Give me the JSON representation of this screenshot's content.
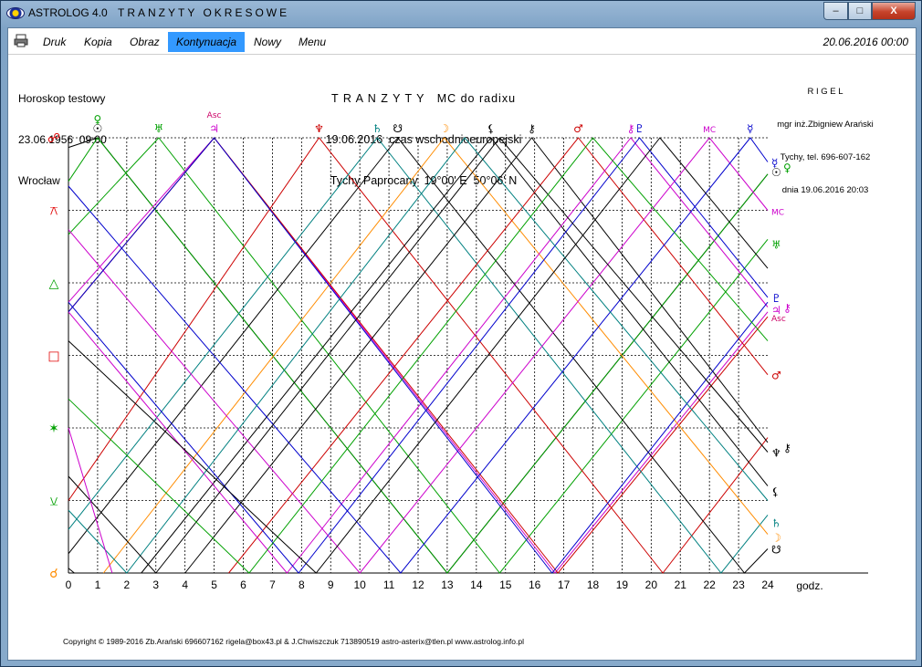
{
  "window": {
    "app_name": "ASTROLOG 4.0",
    "title": "TRANZYTY OKRESOWE",
    "min_label": "–",
    "max_label": "□",
    "close_label": "X"
  },
  "menu": {
    "items": [
      "Druk",
      "Kopia",
      "Obraz",
      "Kontynuacja",
      "Nowy",
      "Menu"
    ],
    "active": "Kontynuacja",
    "date": "20.06.2016  00:00"
  },
  "header": {
    "left": [
      "Horoskop testowy",
      "23.06.1956  09:00",
      "Wrocław"
    ],
    "center_title": "T R A N Z Y T Y   MC do radixu",
    "center_line2": "19.06.2016  czas wschodnioeuropejski",
    "center_line3": "Tychy Paprocany  19°00' E  50°06' N",
    "right": [
      "R I G E L",
      "mgr inż.Zbigniew Arański",
      "Tychy, tel. 696-607-162",
      "dnia 19.06.2016 20:03"
    ]
  },
  "footer": {
    "copyright": "Copyright © 1989-2016 Zb.Arański 696607162 rigela@box43.pl & J.Chwiszczuk 713890519 astro-asterix@tlen.pl www.astrolog.info.pl"
  },
  "chart_data": {
    "type": "line",
    "xlabel": "godz.",
    "x_ticks": [
      0,
      1,
      2,
      3,
      4,
      5,
      6,
      7,
      8,
      9,
      10,
      11,
      12,
      13,
      14,
      15,
      16,
      17,
      18,
      19,
      20,
      21,
      22,
      23,
      24
    ],
    "xlim": [
      0,
      24
    ],
    "ylim": [
      0,
      180
    ],
    "y_aspects": [
      {
        "glyph": "☍",
        "deg": 180,
        "color": "#e00000"
      },
      {
        "glyph": "⚻",
        "deg": 150,
        "color": "#e00000"
      },
      {
        "glyph": "△",
        "deg": 120,
        "color": "#00a000"
      },
      {
        "glyph": "□",
        "deg": 90,
        "color": "#e00000"
      },
      {
        "glyph": "✶",
        "deg": 60,
        "color": "#00a000"
      },
      {
        "glyph": "⚺",
        "deg": 30,
        "color": "#00a000"
      },
      {
        "glyph": "☌",
        "deg": 0,
        "color": "#ff8c00"
      }
    ],
    "top_labels": [
      {
        "glyph": "☉",
        "x": 1.0,
        "color": "#000000"
      },
      {
        "glyph": "♀",
        "x": 1.0,
        "color": "#00a000"
      },
      {
        "glyph": "♅",
        "x": 3.1,
        "color": "#00a000"
      },
      {
        "glyph": "♃",
        "x": 5.0,
        "color": "#cc00cc"
      },
      {
        "glyph": "Asc",
        "x": 5.0,
        "color": "#cc0066"
      },
      {
        "glyph": "♆",
        "x": 8.6,
        "color": "#cc0000"
      },
      {
        "glyph": "♄",
        "x": 10.6,
        "color": "#008080"
      },
      {
        "glyph": "☋",
        "x": 11.3,
        "color": "#000000"
      },
      {
        "glyph": "☽",
        "x": 12.9,
        "color": "#ff8c00"
      },
      {
        "glyph": "⚸",
        "x": 14.5,
        "color": "#000000"
      },
      {
        "glyph": "⚷",
        "x": 15.9,
        "color": "#000000"
      },
      {
        "glyph": "♂",
        "x": 17.5,
        "color": "#cc0000"
      },
      {
        "glyph": "⚷",
        "x": 19.3,
        "color": "#cc00cc"
      },
      {
        "glyph": "♇",
        "x": 19.6,
        "color": "#0000cc"
      },
      {
        "glyph": "MC",
        "x": 22.0,
        "color": "#cc00cc"
      },
      {
        "glyph": "☿",
        "x": 23.4,
        "color": "#0000cc"
      }
    ],
    "right_labels": [
      {
        "glyph": "☿",
        "deg": 170,
        "color": "#0000cc"
      },
      {
        "glyph": "☉",
        "deg": 166,
        "color": "#000000"
      },
      {
        "glyph": "♀",
        "deg": 168,
        "color": "#00a000"
      },
      {
        "glyph": "MC",
        "deg": 150,
        "color": "#cc00cc"
      },
      {
        "glyph": "♅",
        "deg": 136,
        "color": "#00a000"
      },
      {
        "glyph": "♇",
        "deg": 114,
        "color": "#0000cc"
      },
      {
        "glyph": "♃",
        "deg": 109,
        "color": "#cc00cc"
      },
      {
        "glyph": "Asc",
        "deg": 106,
        "color": "#cc0066"
      },
      {
        "glyph": "⚷",
        "deg": 110,
        "color": "#cc00cc"
      },
      {
        "glyph": "♂",
        "deg": 82,
        "color": "#cc0000"
      },
      {
        "glyph": "♆",
        "deg": 50,
        "color": "#000000"
      },
      {
        "glyph": "⚷",
        "deg": 52,
        "color": "#000000"
      },
      {
        "glyph": "⚸",
        "deg": 34,
        "color": "#000000"
      },
      {
        "glyph": "♄",
        "deg": 21,
        "color": "#008080"
      },
      {
        "glyph": "☽",
        "deg": 15,
        "color": "#ff8c00"
      },
      {
        "glyph": "☋",
        "deg": 10,
        "color": "#000000"
      }
    ],
    "series": [
      {
        "color": "#000000",
        "points": [
          [
            0,
            176
          ],
          [
            1,
            180
          ],
          [
            13,
            0
          ],
          [
            24,
            165
          ]
        ]
      },
      {
        "color": "#00a000",
        "points": [
          [
            0,
            162
          ],
          [
            1,
            180
          ],
          [
            13,
            0
          ],
          [
            24,
            165
          ]
        ]
      },
      {
        "color": "#00a000",
        "points": [
          [
            0,
            140
          ],
          [
            3.1,
            180
          ],
          [
            14.8,
            0
          ],
          [
            24,
            138
          ]
        ]
      },
      {
        "color": "#cc00cc",
        "points": [
          [
            0,
            112
          ],
          [
            5,
            180
          ],
          [
            16.7,
            0
          ],
          [
            24,
            108
          ]
        ]
      },
      {
        "color": "#cc0000",
        "points": [
          [
            0,
            108
          ],
          [
            5,
            180
          ],
          [
            16.8,
            0
          ],
          [
            24,
            106
          ]
        ]
      },
      {
        "color": "#cc0000",
        "points": [
          [
            0,
            30
          ],
          [
            8.6,
            180
          ],
          [
            20.4,
            0
          ],
          [
            24,
            56
          ]
        ]
      },
      {
        "color": "#008080",
        "points": [
          [
            0,
            18
          ],
          [
            10.6,
            180
          ],
          [
            22.4,
            0
          ],
          [
            24,
            24
          ]
        ]
      },
      {
        "color": "#000000",
        "points": [
          [
            0,
            8
          ],
          [
            11.3,
            180
          ],
          [
            23.2,
            0
          ],
          [
            24,
            10
          ]
        ]
      },
      {
        "color": "#ff8c00",
        "points": [
          [
            1.2,
            0
          ],
          [
            12.9,
            180
          ],
          [
            24,
            16
          ]
        ]
      },
      {
        "color": "#000000",
        "points": [
          [
            2.5,
            0
          ],
          [
            14.5,
            180
          ],
          [
            24,
            36
          ]
        ]
      },
      {
        "color": "#000000",
        "points": [
          [
            4,
            0
          ],
          [
            15.9,
            180
          ],
          [
            24,
            54
          ]
        ]
      },
      {
        "color": "#cc0000",
        "points": [
          [
            5.5,
            0
          ],
          [
            17.5,
            180
          ],
          [
            24,
            82
          ]
        ]
      },
      {
        "color": "#cc00cc",
        "points": [
          [
            0,
            108
          ],
          [
            7.5,
            0
          ],
          [
            19.3,
            180
          ],
          [
            24,
            110
          ]
        ]
      },
      {
        "color": "#0000cc",
        "points": [
          [
            0,
            112
          ],
          [
            7.9,
            0
          ],
          [
            19.6,
            180
          ],
          [
            24,
            114
          ]
        ]
      },
      {
        "color": "#cc00cc",
        "points": [
          [
            0,
            142
          ],
          [
            10,
            0
          ],
          [
            22,
            180
          ],
          [
            24,
            150
          ]
        ]
      },
      {
        "color": "#0000cc",
        "points": [
          [
            0,
            160
          ],
          [
            11.4,
            0
          ],
          [
            23.4,
            180
          ],
          [
            24,
            170
          ]
        ]
      },
      {
        "color": "#0000cc",
        "points": [
          [
            0,
            108
          ],
          [
            5,
            180
          ],
          [
            16.6,
            0
          ],
          [
            24,
            112
          ]
        ]
      },
      {
        "color": "#008080",
        "points": [
          [
            0,
            26
          ],
          [
            2,
            0
          ],
          [
            13.6,
            180
          ],
          [
            24,
            30
          ]
        ]
      },
      {
        "color": "#000000",
        "points": [
          [
            0,
            40
          ],
          [
            3,
            0
          ],
          [
            14.8,
            180
          ],
          [
            24,
            50
          ]
        ]
      },
      {
        "color": "#00a000",
        "points": [
          [
            0,
            72
          ],
          [
            6.2,
            0
          ],
          [
            18,
            180
          ],
          [
            24,
            96
          ]
        ]
      },
      {
        "color": "#000000",
        "points": [
          [
            0,
            96
          ],
          [
            8.5,
            0
          ],
          [
            20.3,
            180
          ],
          [
            24,
            126
          ]
        ]
      },
      {
        "color": "#cc00cc",
        "points": [
          [
            0,
            60
          ],
          [
            1.5,
            0
          ]
        ]
      },
      {
        "color": "#000000",
        "points": [
          [
            0,
            2
          ],
          [
            0.2,
            0
          ]
        ]
      }
    ]
  }
}
